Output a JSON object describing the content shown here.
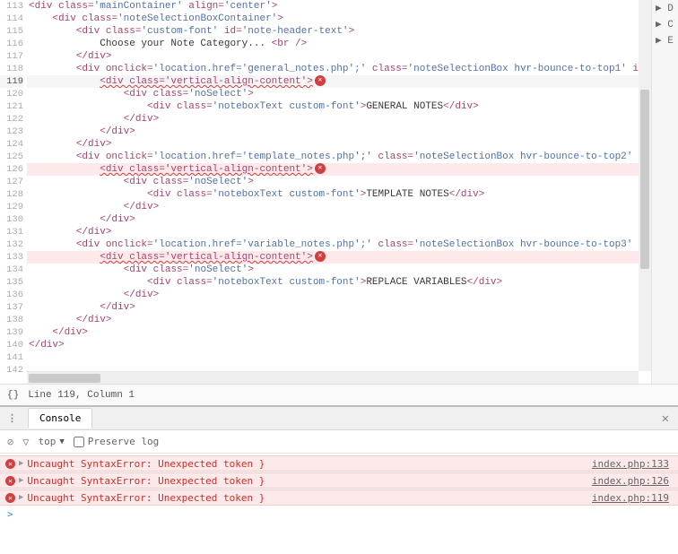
{
  "editor": {
    "lines": {
      "start": 113,
      "end": 142,
      "active": 119
    },
    "code": {
      "l113": {
        "tag_open": "<div",
        "a1": "class",
        "v1": "'mainContainer'",
        "a2": "align",
        "v2": "'center'",
        "close": ">"
      },
      "l114": {
        "tag_open": "<div",
        "a1": "class",
        "v1": "'noteSelectionBoxContainer'",
        "close": ">"
      },
      "l115": {
        "tag_open": "<div",
        "a1": "class",
        "v1": "'custom-font'",
        "a2": "id",
        "v2": "'note-header-text'",
        "close": ">"
      },
      "l116": {
        "text": "Choose your Note Category... ",
        "br": "<br />"
      },
      "l117": {
        "tag_close": "</div>"
      },
      "l118": {
        "tag_open": "<div",
        "a1": "onclick",
        "v1": "'location.href='general_notes.php';'",
        "a2": "class",
        "v2": "'noteSelectionBox hvr-bounce-to-top1'",
        "trail": " id"
      },
      "l119": {
        "wavy": "<div class='vertical-align-content'>"
      },
      "l120": {
        "tag_open": "<div",
        "a1": "class",
        "v1": "'noSelect'",
        "close": ">"
      },
      "l121": {
        "tag_open": "<div",
        "a1": "class",
        "v1": "'noteboxText custom-font'",
        "close": ">",
        "text": "GENERAL NOTES",
        "tag_close": "</div>"
      },
      "l122": {
        "tag_close": "</div>"
      },
      "l123": {
        "tag_close": "</div>"
      },
      "l124": {
        "tag_close": "</div>"
      },
      "l125": {
        "tag_open": "<div",
        "a1": "onclick",
        "v1": "'location.href='template_notes.php';'",
        "a2": "class",
        "v2": "'noteSelectionBox hvr-bounce-to-top2'",
        "trail": " i"
      },
      "l126": {
        "wavy": "<div class='vertical-align-content'>"
      },
      "l127": {
        "tag_open": "<div",
        "a1": "class",
        "v1": "'noSelect'",
        "close": ">"
      },
      "l128": {
        "tag_open": "<div",
        "a1": "class",
        "v1": "'noteboxText custom-font'",
        "close": ">",
        "text": "TEMPLATE NOTES",
        "tag_close": "</div>"
      },
      "l129": {
        "tag_close": "</div>"
      },
      "l130": {
        "tag_close": "</div>"
      },
      "l131": {
        "tag_close": "</div>"
      },
      "l132": {
        "tag_open": "<div",
        "a1": "onclick",
        "v1": "'location.href='variable_notes.php';'",
        "a2": "class",
        "v2": "'noteSelectionBox hvr-bounce-to-top3'",
        "trail": " i"
      },
      "l133": {
        "wavy": "<div class='vertical-align-content'>"
      },
      "l134": {
        "tag_open": "<div",
        "a1": "class",
        "v1": "'noSelect'",
        "close": ">"
      },
      "l135": {
        "tag_open": "<div",
        "a1": "class",
        "v1": "'noteboxText custom-font'",
        "close": ">",
        "text": "REPLACE VARIABLES",
        "tag_close": "</div>"
      },
      "l136": {
        "tag_close": "</div>"
      },
      "l137": {
        "tag_close": "</div>"
      },
      "l138": {
        "tag_close": "</div>"
      },
      "l139": {
        "tag_close": "</div>"
      },
      "l140": {
        "tag_close": "</div>"
      }
    },
    "error_lines": [
      119,
      126,
      133
    ],
    "status": "Line 119, Column 1",
    "side_chars": {
      "c1": "▶ D",
      "c2": "▶ C",
      "c3": "▶ E"
    }
  },
  "console": {
    "tab": "Console",
    "context": "top",
    "preserve_label": "Preserve log",
    "errors": [
      {
        "msg": "Uncaught SyntaxError: Unexpected token }",
        "link": "index.php:133"
      },
      {
        "msg": "Uncaught SyntaxError: Unexpected token }",
        "link": "index.php:126"
      },
      {
        "msg": "Uncaught SyntaxError: Unexpected token }",
        "link": "index.php:119"
      }
    ],
    "prompt": ">"
  },
  "icons": {
    "err_badge": "✕",
    "clear": "⊘",
    "filter": "▽",
    "caret_down": "▼",
    "tri_right": "▶",
    "close_x": "✕",
    "dots": "⋮"
  }
}
